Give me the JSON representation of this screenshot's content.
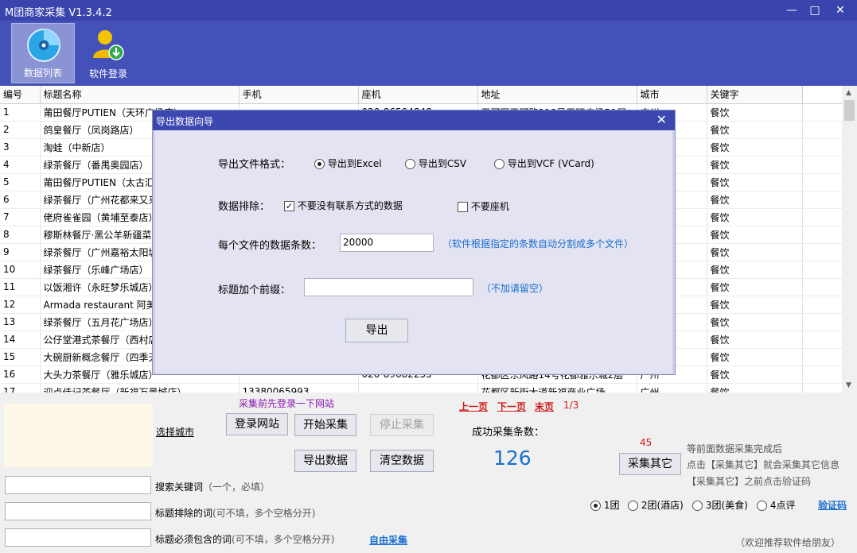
{
  "window": {
    "title": "M团商家采集 V1.3.4.2",
    "min": "—",
    "max": "□",
    "close": "✕"
  },
  "toolbar": {
    "data_list": "数据列表",
    "software_login": "软件登录"
  },
  "grid": {
    "headers": [
      "编号",
      "标题名称",
      "手机",
      "座机",
      "地址",
      "城市",
      "关键字"
    ],
    "rows": [
      [
        "1",
        "莆田餐厅PUTIEN（天环广场店）",
        "",
        "020-86594848",
        "天河区天河路218号天环广场B1层",
        "广州",
        "餐饮"
      ],
      [
        "2",
        "鸽皇餐厅（凤岗路店）",
        "",
        "",
        "",
        "",
        "餐饮"
      ],
      [
        "3",
        "淘蛙（中新店）",
        "",
        "",
        "",
        "",
        "餐饮"
      ],
      [
        "4",
        "绿茶餐厅（番禺奥园店）",
        "",
        "",
        "",
        "",
        "餐饮"
      ],
      [
        "5",
        "莆田餐厅PUTIEN（太古汇店）",
        "",
        "",
        "",
        "",
        "餐饮"
      ],
      [
        "6",
        "绿茶餐厅（广州花都来又来店）",
        "",
        "",
        "",
        "",
        "餐饮"
      ],
      [
        "7",
        "佬府雀雀园（黄埔至泰店）",
        "",
        "",
        "",
        "",
        "餐饮"
      ],
      [
        "8",
        "穆斯林餐厅·黑公羊新疆菜",
        "",
        "",
        "",
        "",
        "餐饮"
      ],
      [
        "9",
        "绿茶餐厅（广州嘉裕太阳城店）",
        "",
        "",
        "",
        "",
        "餐饮"
      ],
      [
        "10",
        "绿茶餐厅（乐峰广场店）",
        "",
        "",
        "",
        "",
        "餐饮"
      ],
      [
        "11",
        "以饭湘许（永旺梦乐城店）",
        "",
        "",
        "",
        "",
        "餐饮"
      ],
      [
        "12",
        "Armada restaurant 阿美达",
        "",
        "",
        "",
        "",
        "餐饮"
      ],
      [
        "13",
        "绿茶餐厅（五月花广场店）",
        "",
        "",
        "",
        "",
        "餐饮"
      ],
      [
        "14",
        "公仔堂港式茶餐厅（西村店）",
        "",
        "",
        "",
        "",
        "餐饮"
      ],
      [
        "15",
        "大碗厨新概念餐厅（四季天地店）",
        "",
        "",
        "",
        "",
        "餐饮"
      ],
      [
        "16",
        "大头力茶餐厅（雅乐城店）",
        "",
        "020-89682255",
        "花都区东风路14号花都雅乐城2层",
        "广州",
        "餐饮"
      ],
      [
        "17",
        "迎点佳记茶餐厅（新福万景城店）",
        "13380065993",
        "",
        "花都区新街大道新福商业广场",
        "广州",
        "餐饮"
      ]
    ]
  },
  "dialog": {
    "title": "导出数据向导",
    "close": "✕",
    "format_label": "导出文件格式：",
    "format_options": [
      "导出到Excel",
      "导出到CSV",
      "导出到VCF (VCard)"
    ],
    "exclude_label": "数据排除：",
    "exclude_no_contact": "不要没有联系方式的数据",
    "exclude_no_landline": "不要座机",
    "per_file_label": "每个文件的数据条数：",
    "per_file_value": "20000",
    "per_file_hint": "（软件根据指定的条数自动分割成多个文件）",
    "prefix_label": "标题加个前缀：",
    "prefix_value": "",
    "prefix_hint": "（不加请留空）",
    "export_button": "导出"
  },
  "bottom": {
    "login_hint": "采集前先登录一下网站",
    "select_city": "选择城市",
    "login_site": "登录网站",
    "start": "开始采集",
    "stop": "停止采集",
    "export": "导出数据",
    "clear": "清空数据",
    "prev": "上一页",
    "next": "下一页",
    "last": "末页",
    "page": "1/3",
    "success_label": "成功采集条数：",
    "success_count": "126",
    "other_count": "45",
    "collect_other": "采集其它",
    "other_note_1": "等前面数据采集完成后",
    "other_note_2": "点击【采集其它】就会采集其它信息",
    "other_note_3": "【采集其它】之前点击验证码",
    "kw_label": "搜索关键词",
    "kw_hint": "（一个，必填）",
    "exclude_words_label": "标题排除的词",
    "exclude_words_hint": "(可不填，多个空格分开)",
    "include_words_label": "标题必须包含的词",
    "include_words_hint": "(可不填，多个空格分开)",
    "free_collect": "自由采集",
    "types": [
      "1团",
      "2团(酒店)",
      "3团(美食)",
      "4点评"
    ],
    "captcha": "验证码",
    "recommend": "（欢迎推荐软件给朋友）"
  }
}
